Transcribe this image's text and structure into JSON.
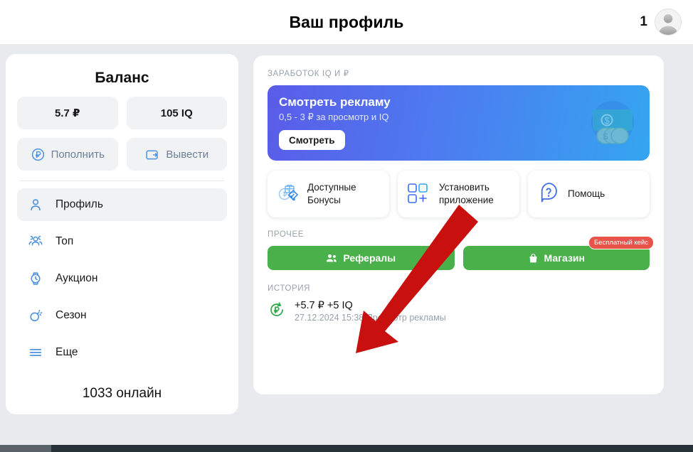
{
  "header": {
    "title": "Ваш профиль",
    "count": "1",
    "avatar_icon": "user-silhouette-avatar"
  },
  "sidebar": {
    "balance_title": "Баланс",
    "chips": [
      {
        "label": "5.7 ₽",
        "name": "balance-rub"
      },
      {
        "label": "105 IQ",
        "name": "balance-iq"
      }
    ],
    "actions": [
      {
        "label": "Пополнить",
        "icon": "ruble-circle-icon"
      },
      {
        "label": "Вывести",
        "icon": "wallet-arrow-icon"
      }
    ],
    "nav": [
      {
        "label": "Профиль",
        "icon": "user-icon",
        "active": true
      },
      {
        "label": "Топ",
        "icon": "people-group-icon",
        "active": false
      },
      {
        "label": "Аукцион",
        "icon": "watch-clock-icon",
        "active": false
      },
      {
        "label": "Сезон",
        "icon": "bomb-icon",
        "active": false
      },
      {
        "label": "Еще",
        "icon": "hamburger-menu-icon",
        "active": false
      }
    ],
    "online": "1033 онлайн"
  },
  "main": {
    "earn_section_label": "Заработок IQ и ₽",
    "banner": {
      "title": "Смотреть рекламу",
      "subtitle": "0,5 - 3 ₽ за просмотр и IQ",
      "button": "Смотреть",
      "art_icon": "banknote-coins-icon",
      "gradient_from": "#5a5ce8",
      "gradient_to": "#35a5f0"
    },
    "tiles": [
      {
        "line1": "Доступные",
        "line2": "Бонусы",
        "icon": "gift-coin-discount-icon"
      },
      {
        "line1": "Установить",
        "line2": "приложение",
        "icon": "apps-grid-plus-icon"
      },
      {
        "line1": "Помощь",
        "line2": "",
        "icon": "question-mark-icon"
      }
    ],
    "other_section_label": "Прочее",
    "green_buttons": [
      {
        "label": "Рефералы",
        "icon": "people-icon",
        "color": "#49b04a"
      },
      {
        "label": "Магазин",
        "icon": "shopping-bag-icon",
        "color": "#49b04a"
      }
    ],
    "case_badge": "Бесплатный кейс",
    "history_section_label": "История",
    "history": [
      {
        "amount": "+5.7 ₽ +5 IQ",
        "meta": "27.12.2024 15:38 Просмотр рекламы",
        "icon": "ruble-refund-icon"
      }
    ]
  },
  "annotation": {
    "arrow_color": "#c8100f",
    "arrow_name": "red-pointer-arrow"
  }
}
